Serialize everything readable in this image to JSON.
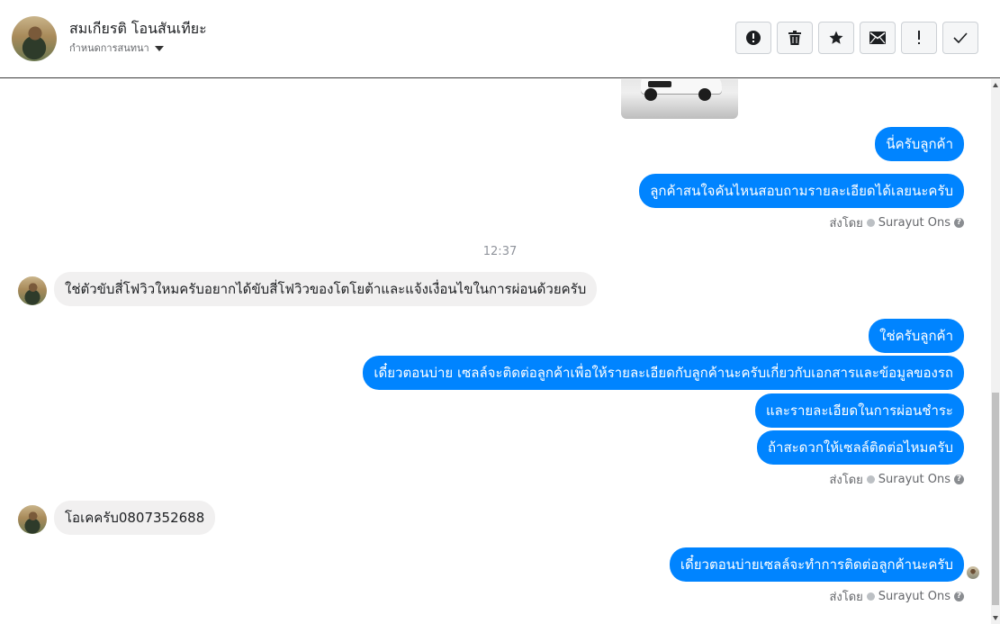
{
  "header": {
    "contact_name": "สมเกียรติ โอนสันเทียะ",
    "assign_label": "กำหนดการสนทนา"
  },
  "toolbar": {
    "buttons": [
      {
        "name": "report-spam-button",
        "icon": "alert-circle-icon"
      },
      {
        "name": "delete-button",
        "icon": "trash-icon"
      },
      {
        "name": "star-button",
        "icon": "star-icon"
      },
      {
        "name": "mark-unread-button",
        "icon": "envelope-icon"
      },
      {
        "name": "follow-up-button",
        "icon": "exclamation-icon"
      },
      {
        "name": "mark-done-button",
        "icon": "check-icon"
      }
    ]
  },
  "messages": {
    "out1": "นี่ครับลูกค้า",
    "out2": "ลูกค้าสนใจคันไหนสอบถามรายละเอียดได้เลยนะครับ",
    "meta1_label": "ส่งโดย",
    "meta1_sender": "Surayut Ons",
    "timestamp": "12:37",
    "in1": "ใช่ตัวขับสี่โฟวิวใหมครับอยากได้ขับสี่โฟวิวของโตโยต้าและแจ้งเงื่อนไขในการผ่อนด้วยครับ",
    "out3": "ใช่ครับลูกค้า",
    "out4": "เดี๋ยวตอนบ่าย เซลล์จะติดต่อลูกค้าเพื่อให้รายละเอียดกับลูกค้านะครับเกี่ยวกับเอกสารและข้อมูลของรถ",
    "out5": "และรายละเอียดในการผ่อนชำระ",
    "out6": "ถ้าสะดวกให้เซลล์ติดต่อไหมครับ",
    "meta2_label": "ส่งโดย",
    "meta2_sender": "Surayut Ons",
    "in2": "โอเคครับ0807352688",
    "out7": "เดี๋ยวตอนบ่ายเซลล์จะทำการติดต่อลูกค้านะครับ",
    "meta3_label": "ส่งโดย",
    "meta3_sender": "Surayut Ons"
  },
  "colors": {
    "outgoing_bubble": "#0084ff",
    "incoming_bubble": "#f1f0f0"
  }
}
